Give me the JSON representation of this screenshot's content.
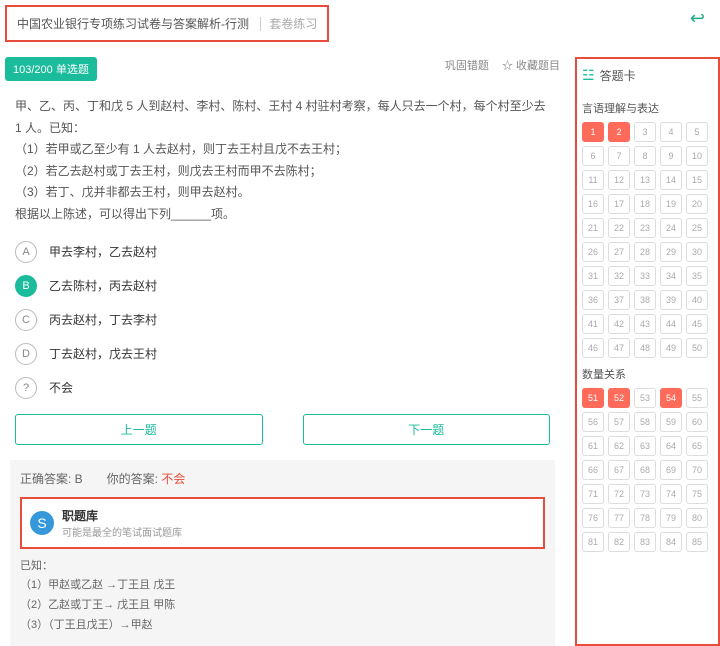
{
  "header": {
    "title": "中国农业银行专项练习试卷与答案解析-行测",
    "sub": "套卷练习"
  },
  "badge": "103/200 单选题",
  "tools": {
    "consolidate": "巩固错题",
    "favorite": "☆ 收藏题目"
  },
  "question": {
    "stem": "甲、乙、丙、丁和戊 5 人到赵村、李村、陈村、王村 4 村驻村考察，每人只去一个村，每个村至少去 1 人。已知：",
    "c1": "（1）若甲或乙至少有 1 人去赵村，则丁去王村且戊不去王村；",
    "c2": "（2）若乙去赵村或丁去王村，则戊去王村而甲不去陈村；",
    "c3": "（3）若丁、戊并非都去王村，则甲去赵村。",
    "tail": "根据以上陈述，可以得出下列______项。"
  },
  "options": [
    {
      "k": "A",
      "t": "甲去李村，乙去赵村"
    },
    {
      "k": "B",
      "t": "乙去陈村，丙去赵村"
    },
    {
      "k": "C",
      "t": "丙去赵村，丁去李村"
    },
    {
      "k": "D",
      "t": "丁去赵村，戊去王村"
    },
    {
      "k": "?",
      "t": "不会"
    }
  ],
  "nav": {
    "prev": "上一题",
    "next": "下一题"
  },
  "answer": {
    "label": "正确答案: B　　你的答案: ",
    "yours": "不会"
  },
  "promo": {
    "title": "职题库",
    "sub": "可能是最全的笔试面试题库"
  },
  "explain": {
    "h": "已知：",
    "l1": "（1）甲赵或乙赵 →丁王且 戊王",
    "l2": "（2）乙赵或丁王→ 戊王且 甲陈",
    "l3": "（3）（丁王且戊王）→甲赵"
  },
  "card": {
    "title": "答题卡",
    "s1": "言语理解与表达",
    "s2": "数量关系"
  },
  "grid1": {
    "start": 1,
    "end": 50,
    "done": [
      1,
      2
    ]
  },
  "grid2": {
    "start": 51,
    "end": 85,
    "done": [
      51,
      52,
      54
    ]
  }
}
